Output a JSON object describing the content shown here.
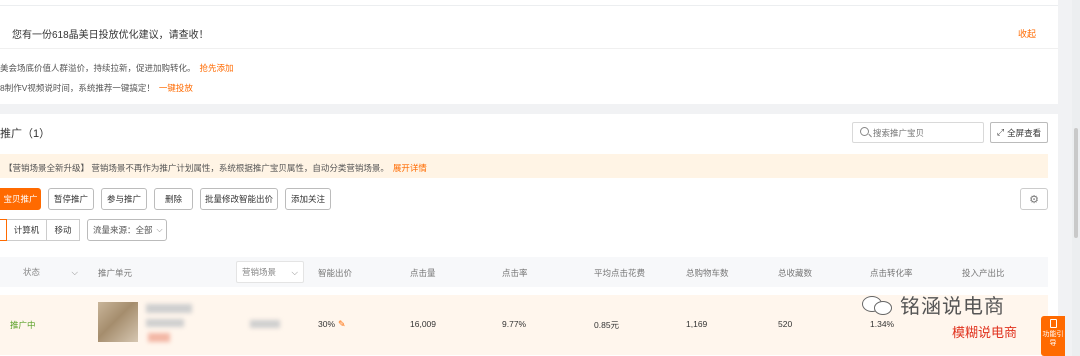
{
  "notice": {
    "title": "您有一份618晶美日投放优化建议，请查收！",
    "collapse_label": "收起",
    "suggestions": [
      {
        "text": "美会场底价值人群溢价，持续拉新，促进加购转化。",
        "action": "抢先添加"
      },
      {
        "text": "8制作V视频说时间，系统推荐一键搞定！",
        "action": "一键投放"
      }
    ]
  },
  "section": {
    "title": "推广（1）",
    "search_placeholder": "搜索推广宝贝",
    "fullscreen_label": "全屏查看"
  },
  "banner": {
    "text": "【营销场景全新升级】 营销场景不再作为推广计划属性，系统根据推广宝贝属性，自动分类营销场景。",
    "link": "展开详情"
  },
  "toolbar": {
    "buttons": [
      "宝贝推广",
      "暂停推广",
      "参与推广",
      "删除",
      "批量修改智能出价",
      "添加关注"
    ]
  },
  "filters": {
    "device_tabs": [
      "计算机",
      "移动"
    ],
    "traffic_source": "流量来源：全部"
  },
  "table": {
    "headers": {
      "status": "状态",
      "unit": "推广单元",
      "scene": "营销场景",
      "bid": "智能出价",
      "clicks": "点击量",
      "ctr": "点击率",
      "avg_cost": "平均点击花费",
      "cart": "总购物车数",
      "fav": "总收藏数",
      "cvr": "点击转化率",
      "roi": "投入产出比"
    },
    "rows": [
      {
        "status": "推广中",
        "bid": "30%",
        "clicks": "16,009",
        "ctr": "9.77%",
        "avg_cost": "0.85元",
        "cart": "1,169",
        "fav": "520",
        "cvr": "1.34%"
      }
    ]
  },
  "watermark": {
    "name": "铭涵说电商",
    "sub": "模糊说电商"
  },
  "float_guide": {
    "label": "功能引导"
  },
  "colors": {
    "accent": "#ff6a00",
    "status_green": "#5aa128",
    "banner_bg": "#fff4e5"
  }
}
